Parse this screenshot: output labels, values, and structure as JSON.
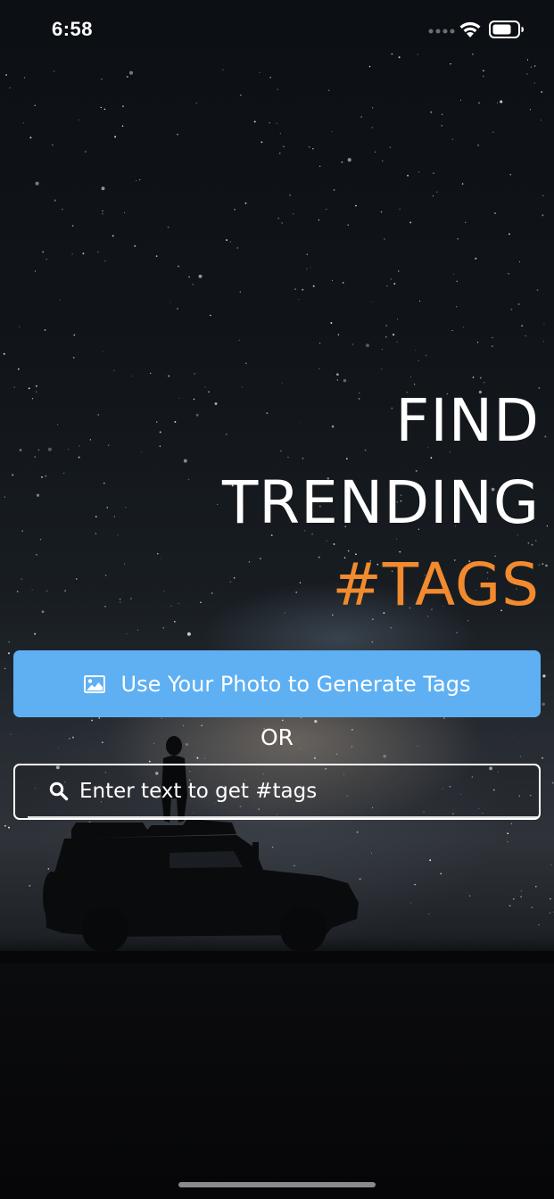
{
  "status_bar": {
    "time": "6:58",
    "icons": [
      "signal-dots-icon",
      "wifi-icon",
      "battery-icon"
    ]
  },
  "headline": {
    "line1": "FIND",
    "line2": "TRENDING",
    "line3": "#TAGS"
  },
  "photo_button": {
    "icon": "image-icon",
    "label": "Use Your Photo to Generate Tags"
  },
  "separator": {
    "text": "OR"
  },
  "search": {
    "icon": "search-icon",
    "value": "",
    "placeholder": "Enter text to get #tags"
  },
  "colors": {
    "accent": "#f28a2e",
    "button": "#5eb0f3",
    "text": "#ffffff",
    "background": "#050507"
  }
}
